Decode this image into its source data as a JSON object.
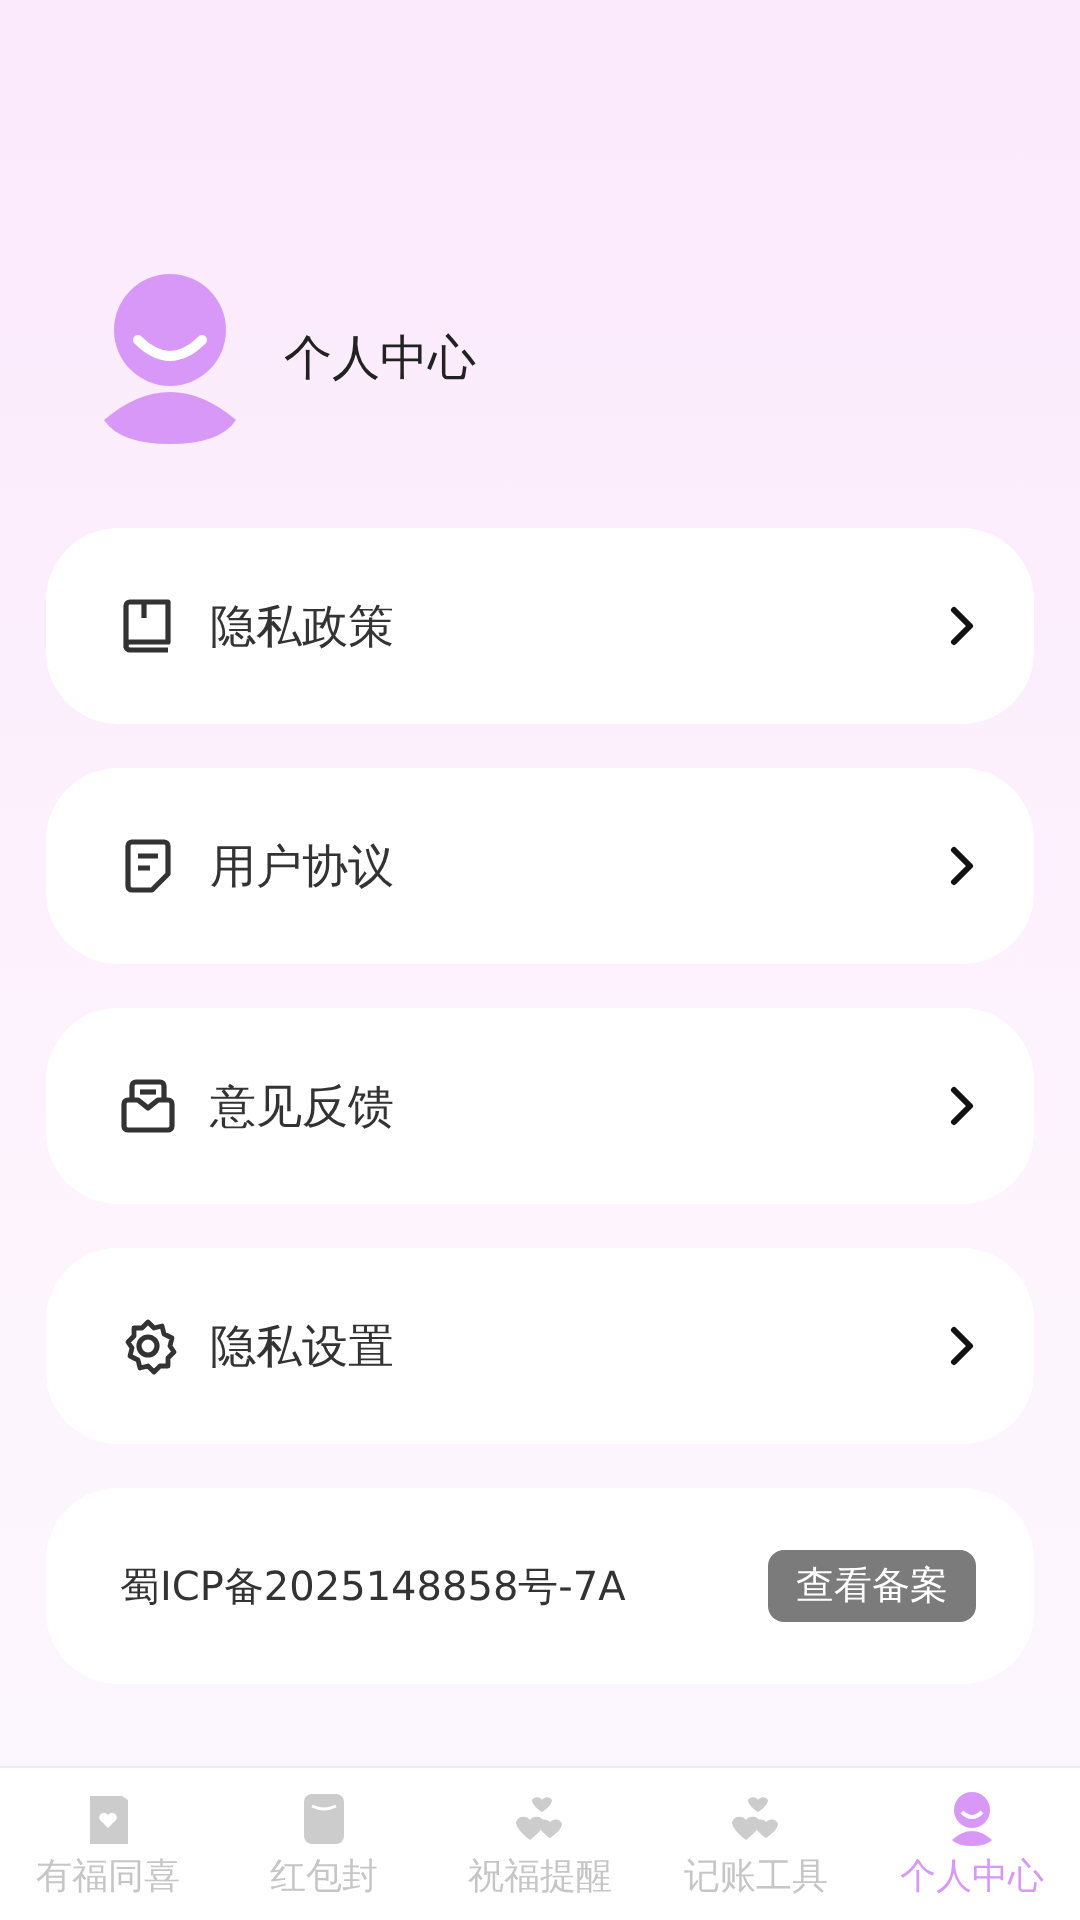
{
  "profile": {
    "title": "个人中心"
  },
  "menu": [
    {
      "kind": "book",
      "label": "隐私政策"
    },
    {
      "kind": "document",
      "label": "用户协议"
    },
    {
      "kind": "inbox",
      "label": "意见反馈"
    },
    {
      "kind": "gear",
      "label": "隐私设置"
    }
  ],
  "icp": {
    "text": "蜀ICP备2025148858号-7A",
    "button": "查看备案"
  },
  "tabs": [
    {
      "kind": "card",
      "label": "有福同喜",
      "selected": false
    },
    {
      "kind": "envelope",
      "label": "红包封",
      "selected": false
    },
    {
      "kind": "hearts",
      "label": "祝福提醒",
      "selected": false
    },
    {
      "kind": "hearts",
      "label": "记账工具",
      "selected": false
    },
    {
      "kind": "person",
      "label": "个人中心",
      "selected": true
    }
  ]
}
